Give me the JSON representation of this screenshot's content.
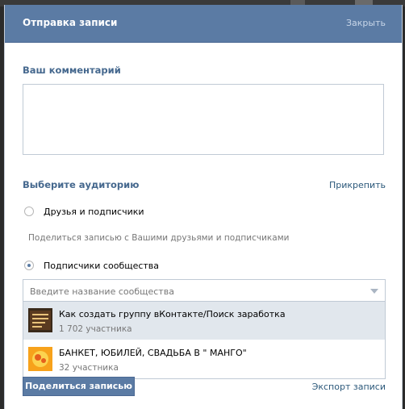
{
  "dialog": {
    "title": "Отправка записи",
    "close_label": "Закрыть"
  },
  "comment": {
    "heading": "Ваш комментарий",
    "value": ""
  },
  "audience": {
    "heading": "Выберите аудиторию",
    "attach_label": "Прикрепить",
    "options": [
      {
        "label": "Друзья и подписчики",
        "checked": false,
        "hint": "Поделиться записью с Вашими друзьями и подписчиками"
      },
      {
        "label": "Подписчики сообщества",
        "checked": true
      }
    ]
  },
  "community_search": {
    "placeholder": "Введите название сообщества",
    "results": [
      {
        "name": "Как создать группу вКонтакте/Поиск заработка",
        "members": "1 702 участника"
      },
      {
        "name": "БАНКЕТ, ЮБИЛЕЙ, СВАДЬБА В \" МАНГО\"",
        "members": "32 участника"
      }
    ]
  },
  "footer": {
    "share_label": "Поделиться записью",
    "export_label": "Экспорт записи"
  },
  "colors": {
    "header_bg": "#5b7ba4",
    "heading_text": "#45688e",
    "link_text": "#2b587a",
    "hover_row": "#e1e7ed"
  }
}
